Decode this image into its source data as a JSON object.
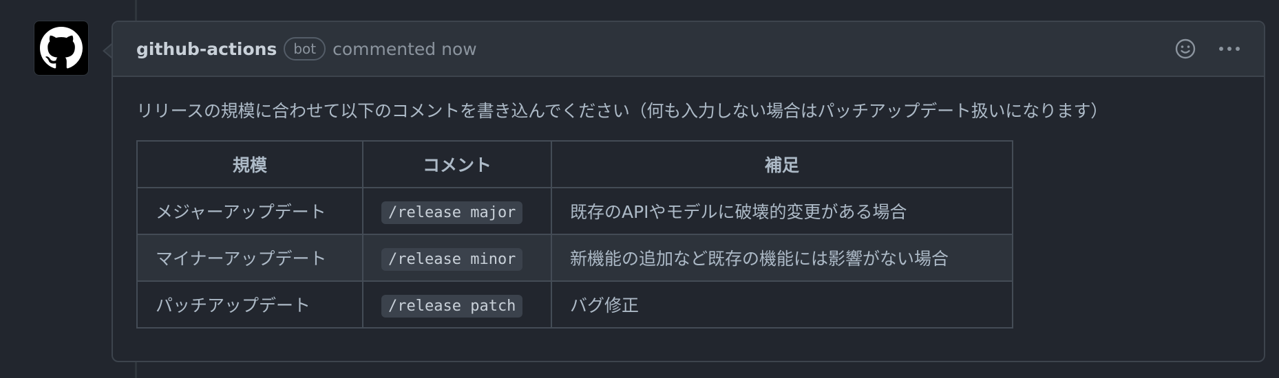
{
  "comment": {
    "author": "github-actions",
    "badge": "bot",
    "action": "commented now",
    "intro": "リリースの規模に合わせて以下のコメントを書き込んでください（何も入力しない場合はパッチアップデート扱いになります）",
    "table": {
      "headers": [
        "規模",
        "コメント",
        "補足"
      ],
      "rows": [
        [
          "メジャーアップデート",
          "/release major",
          "既存のAPIやモデルに破壊的変更がある場合"
        ],
        [
          "マイナーアップデート",
          "/release minor",
          "新機能の追加など既存の機能には影響がない場合"
        ],
        [
          "パッチアップデート",
          "/release patch",
          "バグ修正"
        ]
      ]
    }
  },
  "icons": {
    "avatar": "github-logo-icon",
    "reaction": "smiley-icon",
    "menu": "kebab-horizontal-icon"
  },
  "colors": {
    "background": "#22262e",
    "header": "#2d333b",
    "border": "#3d444d",
    "text": "#adbac7",
    "muted": "#8b949e"
  }
}
